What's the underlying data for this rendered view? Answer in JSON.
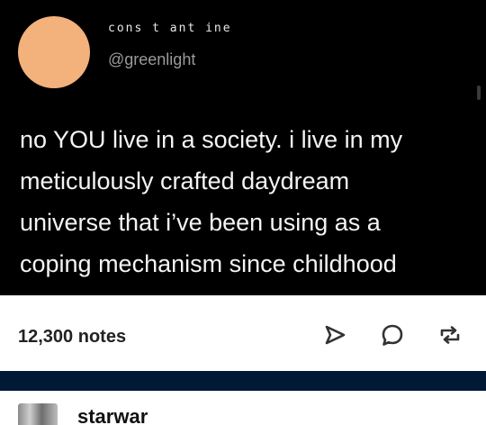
{
  "post": {
    "display_name": "cons t ant ine",
    "handle": "@greenlight",
    "text_lines": [
      "no YOU live in a society. i live in my",
      "meticulously crafted daydream",
      "universe that i’ve been using as a",
      "coping mechanism since childhood"
    ],
    "avatar_color": "#f3b17c"
  },
  "footer": {
    "notes": "12,300 notes",
    "actions": [
      {
        "icon": "share-icon"
      },
      {
        "icon": "reply-icon"
      },
      {
        "icon": "reblog-icon"
      }
    ]
  },
  "next_post": {
    "username": "starwar"
  },
  "colors": {
    "tweet_bg": "#000000",
    "divider_band": "#001935",
    "footer_bg": "#ffffff"
  }
}
